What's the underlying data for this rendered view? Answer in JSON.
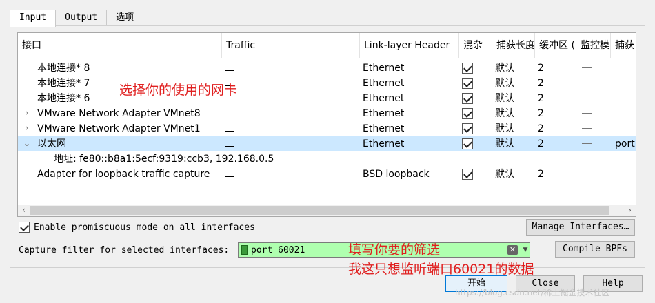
{
  "tabs": [
    {
      "label": "Input"
    },
    {
      "label": "Output"
    },
    {
      "label": "选项"
    }
  ],
  "table": {
    "columns": [
      "接口",
      "Traffic",
      "Link-layer Header",
      "混杂",
      "捕获长度",
      "缓冲区 (",
      "监控模",
      "捕获"
    ],
    "rows": [
      {
        "name": "本地连接* 8",
        "traffic": "__",
        "link": "Ethernet",
        "snap": "默认",
        "buffer": "2",
        "monitor": "—",
        "filter": ""
      },
      {
        "name": "本地连接* 7",
        "traffic": "__",
        "link": "Ethernet",
        "snap": "默认",
        "buffer": "2",
        "monitor": "—",
        "filter": ""
      },
      {
        "name": "本地连接* 6",
        "traffic": "__",
        "link": "Ethernet",
        "snap": "默认",
        "buffer": "2",
        "monitor": "—",
        "filter": ""
      },
      {
        "name": "VMware Network Adapter VMnet8",
        "traffic": "__",
        "link": "Ethernet",
        "snap": "默认",
        "buffer": "2",
        "monitor": "—",
        "filter": ""
      },
      {
        "name": "VMware Network Adapter VMnet1",
        "traffic": "__",
        "link": "Ethernet",
        "snap": "默认",
        "buffer": "2",
        "monitor": "—",
        "filter": ""
      },
      {
        "name": "以太网",
        "traffic": "__",
        "link": "Ethernet",
        "snap": "默认",
        "buffer": "2",
        "monitor": "—",
        "filter": "port"
      },
      {
        "name": "地址: fe80::b8a1:5ecf:9319:ccb3, 192.168.0.5"
      },
      {
        "name": "Adapter for loopback traffic capture",
        "traffic": "__",
        "link": "BSD loopback",
        "snap": "默认",
        "buffer": "2",
        "monitor": "—",
        "filter": ""
      }
    ]
  },
  "promisc_label": "Enable promiscuous mode on all interfaces",
  "manage_button": "Manage Interfaces…",
  "filter_label": "Capture filter for selected interfaces:",
  "filter_value": "port 60021",
  "compile_button": "Compile BPFs",
  "start_button": "开始",
  "close_button": "Close",
  "help_button": "Help",
  "annotations": {
    "select_nic": "选择你的使用的网卡",
    "fill_filter": "填写你要的筛选",
    "port_note": "我这只想监听端口60021的数据"
  },
  "watermark": "https://blog.csdn.net/稀土掘金技术社区",
  "colors": {
    "selection": "#cce8ff",
    "filter_bg": "#afffaf",
    "annotation": "#e02020"
  }
}
